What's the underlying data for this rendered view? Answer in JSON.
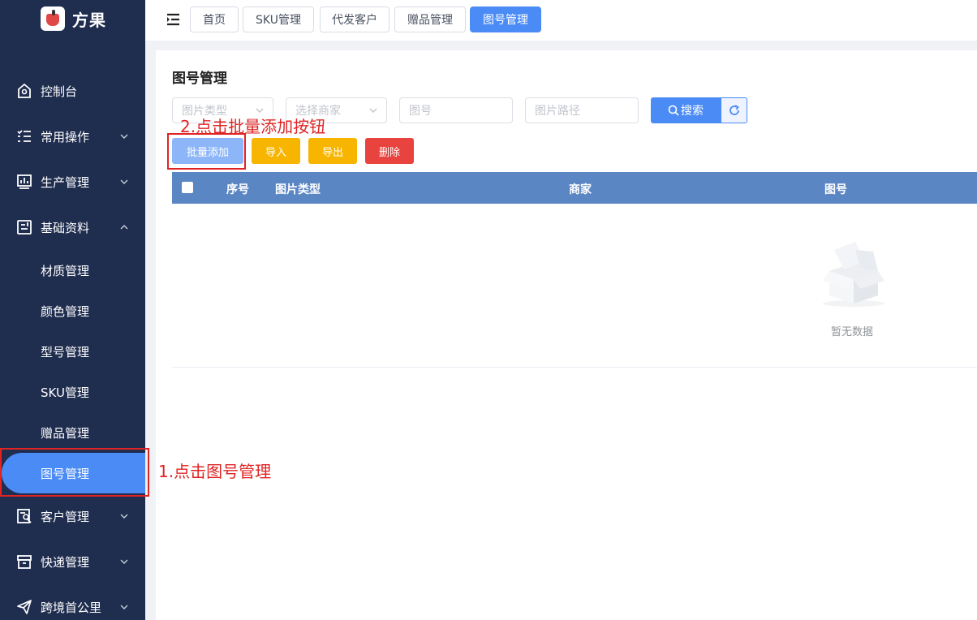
{
  "app": {
    "name": "方果"
  },
  "tabs": [
    {
      "label": "首页",
      "active": false
    },
    {
      "label": "SKU管理",
      "active": false
    },
    {
      "label": "代发客户",
      "active": false
    },
    {
      "label": "赠品管理",
      "active": false
    },
    {
      "label": "图号管理",
      "active": true
    }
  ],
  "sidebar": {
    "items": [
      {
        "label": "控制台",
        "icon": "home-icon"
      },
      {
        "label": "常用操作",
        "icon": "list-icon",
        "expanded": false
      },
      {
        "label": "生产管理",
        "icon": "chart-icon",
        "expanded": false
      },
      {
        "label": "基础资料",
        "icon": "document-icon",
        "expanded": true
      },
      {
        "label": "客户管理",
        "icon": "customer-icon",
        "expanded": false
      },
      {
        "label": "快递管理",
        "icon": "box-icon",
        "expanded": false
      },
      {
        "label": "跨境首公里",
        "icon": "send-icon",
        "expanded": false
      }
    ],
    "subitems": [
      {
        "label": "材质管理"
      },
      {
        "label": "颜色管理"
      },
      {
        "label": "型号管理"
      },
      {
        "label": "SKU管理"
      },
      {
        "label": "赠品管理"
      },
      {
        "label": "图号管理",
        "active": true
      }
    ]
  },
  "annotations": {
    "step1": "1.点击图号管理",
    "step2": "2.点击批量添加按钮"
  },
  "page": {
    "title": "图号管理",
    "filters": {
      "image_type_placeholder": "图片类型",
      "merchant_placeholder": "选择商家",
      "drawing_no_placeholder": "图号",
      "image_path_placeholder": "图片路径"
    },
    "search_label": "搜索",
    "actions": {
      "batch_add": "批量添加",
      "import": "导入",
      "export": "导出",
      "delete": "删除"
    },
    "table": {
      "columns": [
        "序号",
        "图片类型",
        "商家",
        "图号"
      ],
      "rows": [],
      "empty_text": "暂无数据"
    }
  },
  "colors": {
    "sidebar_bg": "#1f2d4f",
    "primary": "#4a8bf5",
    "warning": "#f7b500",
    "danger": "#e8433e",
    "annotation": "#e02424",
    "table_header": "#5b86c4"
  }
}
